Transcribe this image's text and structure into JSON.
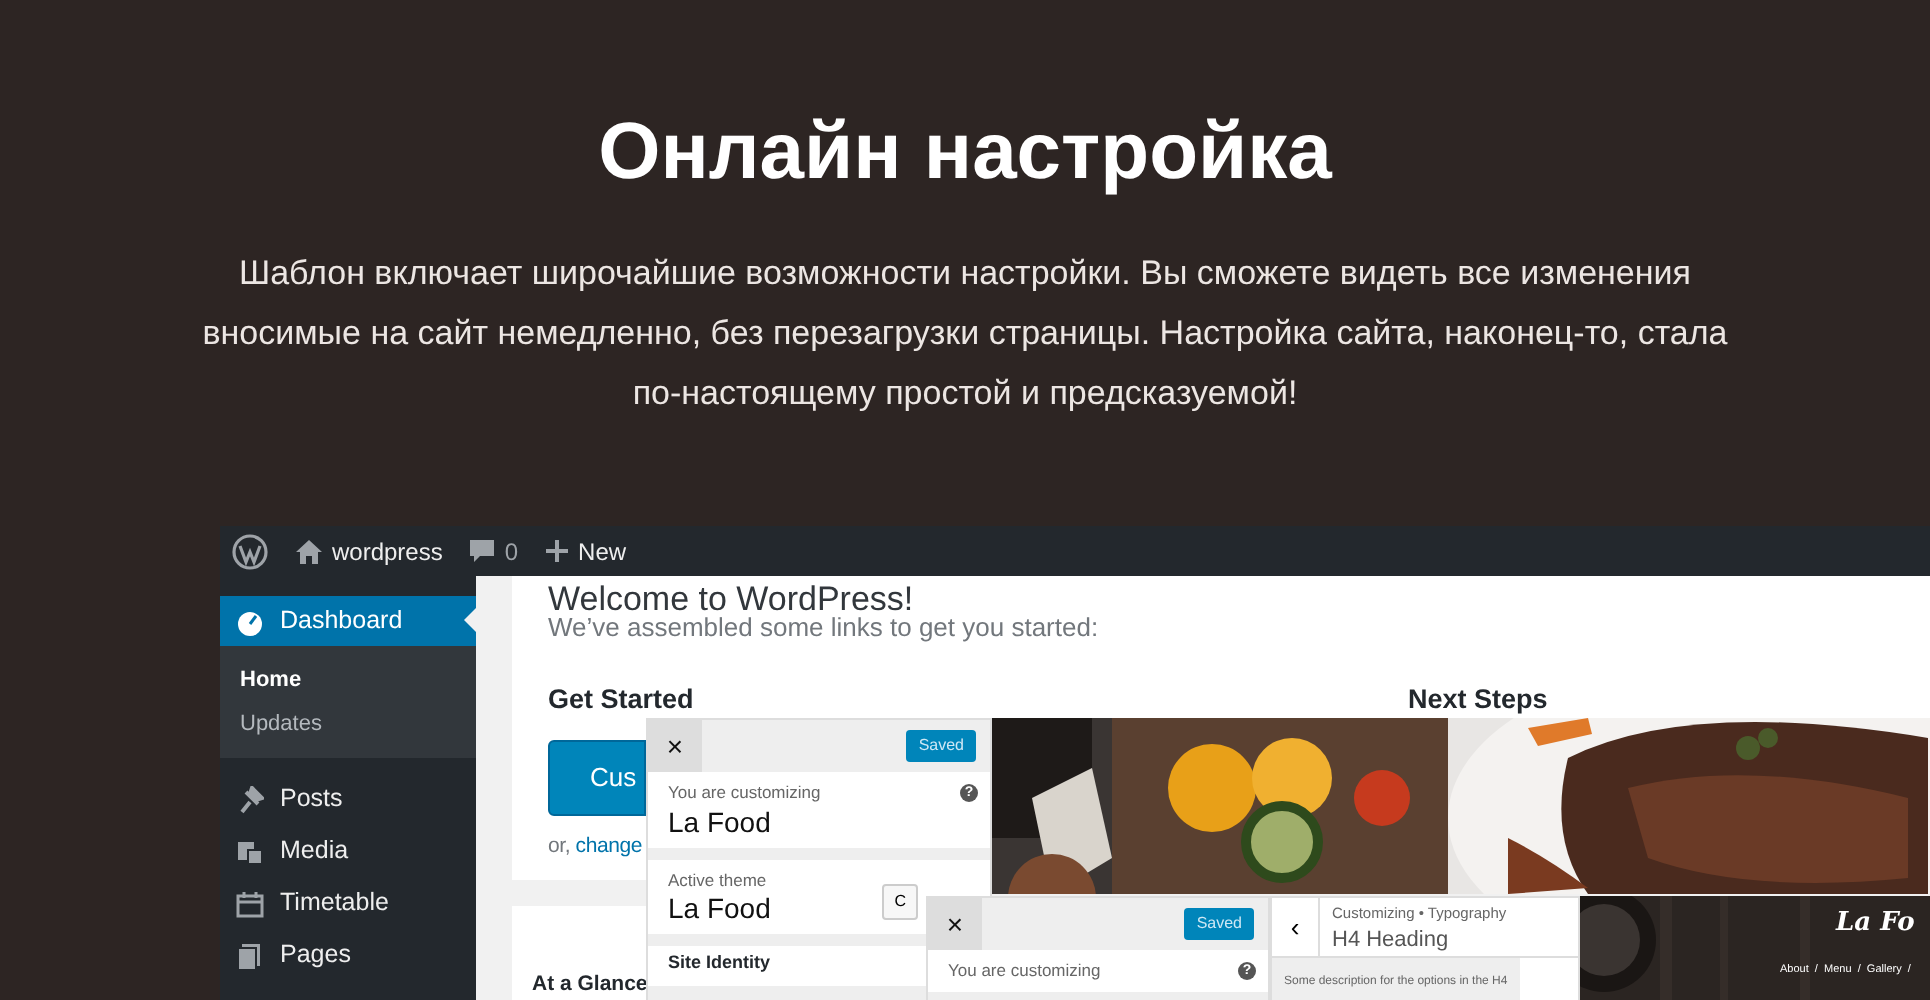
{
  "header": {
    "title": "Онлайн настройка",
    "description": "Шаблон включает широчайшие возможности настройки. Вы сможете видеть все изменения вносимые на сайт немедленно, без перезагрузки страницы. Настройка сайта, наконец-то, стала по-настоящему простой и предсказуемой!"
  },
  "admin_bar": {
    "site": "wordpress",
    "comments": "0",
    "new": "New"
  },
  "sidebar": {
    "items": [
      {
        "label": "Dashboard",
        "selected": true,
        "children": [
          {
            "label": "Home",
            "selected": true
          },
          {
            "label": "Updates",
            "selected": false
          }
        ]
      },
      {
        "label": "Posts",
        "selected": false
      },
      {
        "label": "Media",
        "selected": false
      },
      {
        "label": "Timetable",
        "selected": false
      },
      {
        "label": "Pages",
        "selected": false
      }
    ]
  },
  "welcome": {
    "title": "Welcome to WordPress!",
    "subtitle": "We’ve assembled some links to get you started:",
    "get_started": "Get Started",
    "button": "Cus",
    "alt_prefix": "or,",
    "alt_link": "change",
    "next_steps": "Next Steps"
  },
  "at_a_glance": "At a Glance",
  "customizer_panels": [
    {
      "close": "×",
      "status": "Saved",
      "label": "You are customizing",
      "help": "?",
      "site": "La Food",
      "active_theme_label": "Active theme",
      "active_theme": "La Food",
      "change_button": "C",
      "section": "Site Identity"
    },
    {
      "close": "×",
      "status": "Saved",
      "label": "You are customizing",
      "help": "?"
    }
  ],
  "typography_panel": {
    "back": "‹",
    "breadcrumb": "Customizing • Typography",
    "title": "H4 Heading",
    "description": "Some description for the options in the H4"
  },
  "site_preview": {
    "logo": "La Fo",
    "nav": "About  /  Menu  /  Gallery  /"
  }
}
